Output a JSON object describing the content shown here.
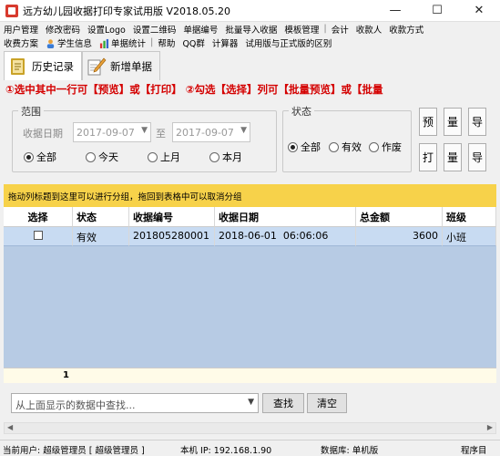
{
  "window": {
    "title": "远方幼儿园收据打印专家试用版 V2018.05.20",
    "minimize": "—",
    "maximize": "☐",
    "close": "✕"
  },
  "menu1": [
    "用户管理",
    "修改密码",
    "设置Logo",
    "设置二维码",
    "单据编号",
    "批量导入收据",
    "模板管理",
    "|",
    "会计",
    "收款人",
    "收款方式"
  ],
  "menu2": {
    "m1": "收费方案",
    "m2": "学生信息",
    "m3": "单据统计",
    "sep": "|",
    "m4": "帮助",
    "m5": "QQ群",
    "m6": "计算器",
    "m7": "试用版与正式版的区别"
  },
  "tabs": {
    "history": "历史记录",
    "new": "新增单据"
  },
  "hint": "①选中其中一行可【预览】或【打印】   ②勾选【选择】列可【批量预览】或【批量",
  "range": {
    "title": "范围",
    "date_label": "收据日期",
    "from": "2017-09-07",
    "to_label": "至",
    "to": "2017-09-07",
    "options": [
      "全部",
      "今天",
      "上月",
      "本月"
    ],
    "selected": "全部"
  },
  "status": {
    "title": "状态",
    "options": [
      "全部",
      "有效",
      "作废"
    ],
    "selected": "全部"
  },
  "side_buttons": {
    "preview": "预",
    "batch_preview": "量",
    "export": "导",
    "print": "打",
    "batch_print": "量",
    "export2": "导"
  },
  "group_bar": "拖动列标题到这里可以进行分组，拖回到表格中可以取消分组",
  "table": {
    "columns": [
      "选择",
      "状态",
      "收据编号",
      "收据日期",
      "总金额",
      "班级"
    ],
    "rows": [
      {
        "status": "有效",
        "number": "201805280001",
        "date": "2018-06-01  06:06:06",
        "amount": "3600",
        "class": "小班"
      }
    ],
    "footer_count": "1"
  },
  "search": {
    "placeholder": "从上面显示的数据中查找...",
    "find": "查找",
    "clear": "清空"
  },
  "statusbar": {
    "user": "当前用户: 超级管理员 [ 超级管理员 ]",
    "ip": "本机 IP: 192.168.1.90",
    "db": "数据库: 单机版",
    "dir": "程序目"
  }
}
